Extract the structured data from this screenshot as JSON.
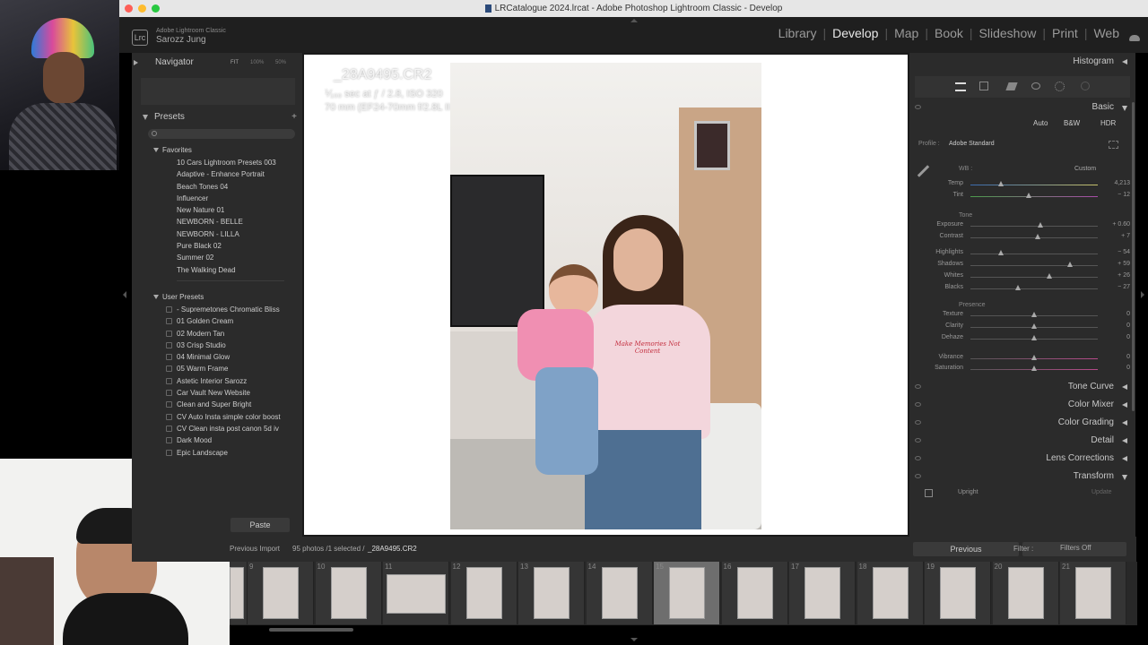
{
  "window": {
    "title": "LRCatalogue 2024.lrcat - Adobe Photoshop Lightroom Classic - Develop"
  },
  "identity": {
    "app": "Adobe Lightroom Classic",
    "user": "Sarozz Jung",
    "badge": "Lrc"
  },
  "modules": [
    "Library",
    "Develop",
    "Map",
    "Book",
    "Slideshow",
    "Print",
    "Web"
  ],
  "active_module": "Develop",
  "left": {
    "navigator": {
      "title": "Navigator",
      "zooms": [
        "FIT",
        "100%",
        "50%"
      ]
    },
    "presets": {
      "title": "Presets",
      "search_placeholder": "",
      "groups": [
        {
          "name": "Favorites",
          "items": [
            "10 Cars Lightroom Presets 003",
            "Adaptive - Enhance Portrait",
            "Beach Tones 04",
            "Influencer",
            "New Nature 01",
            "NEWBORN - BELLE",
            "NEWBORN - LILLA",
            "Pure Black 02",
            "Summer 02",
            "The Walking Dead"
          ]
        },
        {
          "name": "User Presets",
          "items": [
            "- Supremetones Chromatic Bliss",
            "01 Golden Cream",
            "02 Modern Tan",
            "03 Crisp Studio",
            "04 Minimal Glow",
            "05 Warm Frame",
            "Astetic Interior Sarozz",
            "Car Vault New Website",
            "Clean and Super Bright",
            "CV Auto Insta simple color boost",
            "CV Clean insta post canon 5d iv",
            "Dark Mood",
            "Epic Landscape"
          ]
        }
      ]
    },
    "paste": "Paste"
  },
  "photo_info": {
    "filename": "_28A9495.CR2",
    "exposure": "⅟₁₀₀ sec at ƒ / 2.8, ISO 320",
    "lens": "70 mm (EF24-70mm f/2.8L II USM)",
    "shirt_text": "Make Memories Not Content"
  },
  "right": {
    "histogram": "Histogram",
    "basic": {
      "title": "Basic",
      "buttons": [
        "Auto",
        "B&W",
        "HDR"
      ],
      "profile_label": "Profile :",
      "profile_value": "Adobe Standard",
      "wb_label": "WB :",
      "wb_value": "Custom",
      "tone_label": "Tone",
      "presence_label": "Presence",
      "sliders": [
        {
          "label": "Temp",
          "value": "4,213",
          "pos": 0.24
        },
        {
          "label": "Tint",
          "value": "− 12",
          "pos": 0.46
        },
        {
          "label": "Exposure",
          "value": "+ 0.60",
          "pos": 0.55
        },
        {
          "label": "Contrast",
          "value": "+ 7",
          "pos": 0.53
        },
        {
          "label": "Highlights",
          "value": "− 54",
          "pos": 0.24
        },
        {
          "label": "Shadows",
          "value": "+ 59",
          "pos": 0.78
        },
        {
          "label": "Whites",
          "value": "+ 26",
          "pos": 0.62
        },
        {
          "label": "Blacks",
          "value": "− 27",
          "pos": 0.37
        },
        {
          "label": "Texture",
          "value": "0",
          "pos": 0.5
        },
        {
          "label": "Clarity",
          "value": "0",
          "pos": 0.5
        },
        {
          "label": "Dehaze",
          "value": "0",
          "pos": 0.5
        },
        {
          "label": "Vibrance",
          "value": "0",
          "pos": 0.5
        },
        {
          "label": "Saturation",
          "value": "0",
          "pos": 0.5
        }
      ]
    },
    "sections": [
      "Tone Curve",
      "Color Mixer",
      "Color Grading",
      "Detail",
      "Lens Corrections",
      "Transform"
    ],
    "transform": {
      "upright": "Upright",
      "update": "Update"
    },
    "previous": "Previous",
    "reset": "Reset"
  },
  "filmstrip": {
    "source": "Previous Import",
    "count": "95 photos /1 selected /",
    "current": "_28A9495.CR2",
    "filter_label": "Filter :",
    "filter_value": "Filters Off",
    "numbers": [
      "9",
      "10",
      "11",
      "12",
      "13",
      "14",
      "15",
      "16",
      "17",
      "18",
      "19",
      "20",
      "21"
    ],
    "selected_index": 6
  }
}
